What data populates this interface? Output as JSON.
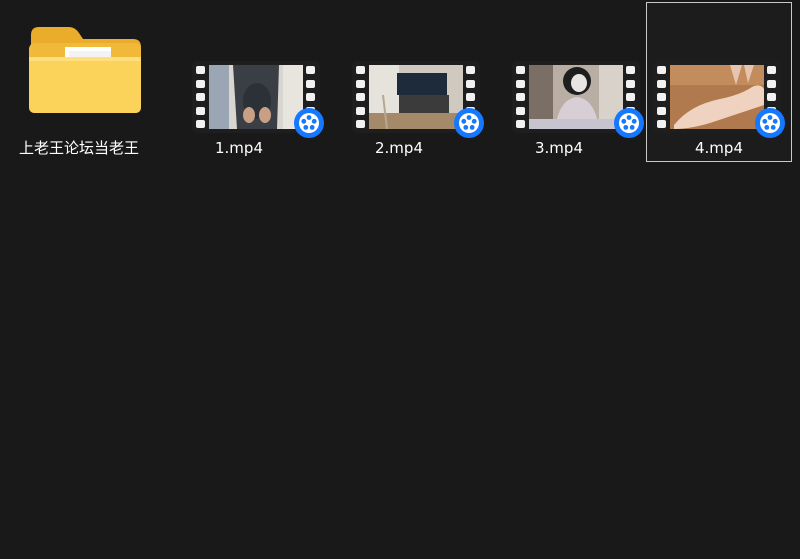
{
  "items": [
    {
      "label": "上老王论坛当老王",
      "icon": "folder-icon"
    },
    {
      "label": "1.mp4",
      "icon": "video-file-icon"
    },
    {
      "label": "2.mp4",
      "icon": "video-file-icon"
    },
    {
      "label": "3.mp4",
      "icon": "video-file-icon"
    },
    {
      "label": "4.mp4",
      "icon": "video-file-icon",
      "selected": true
    }
  ],
  "colors": {
    "background": "#191919",
    "folder": "#f5c748",
    "player_badge": "#1677ff",
    "selection_border": "#c9c9c9"
  }
}
